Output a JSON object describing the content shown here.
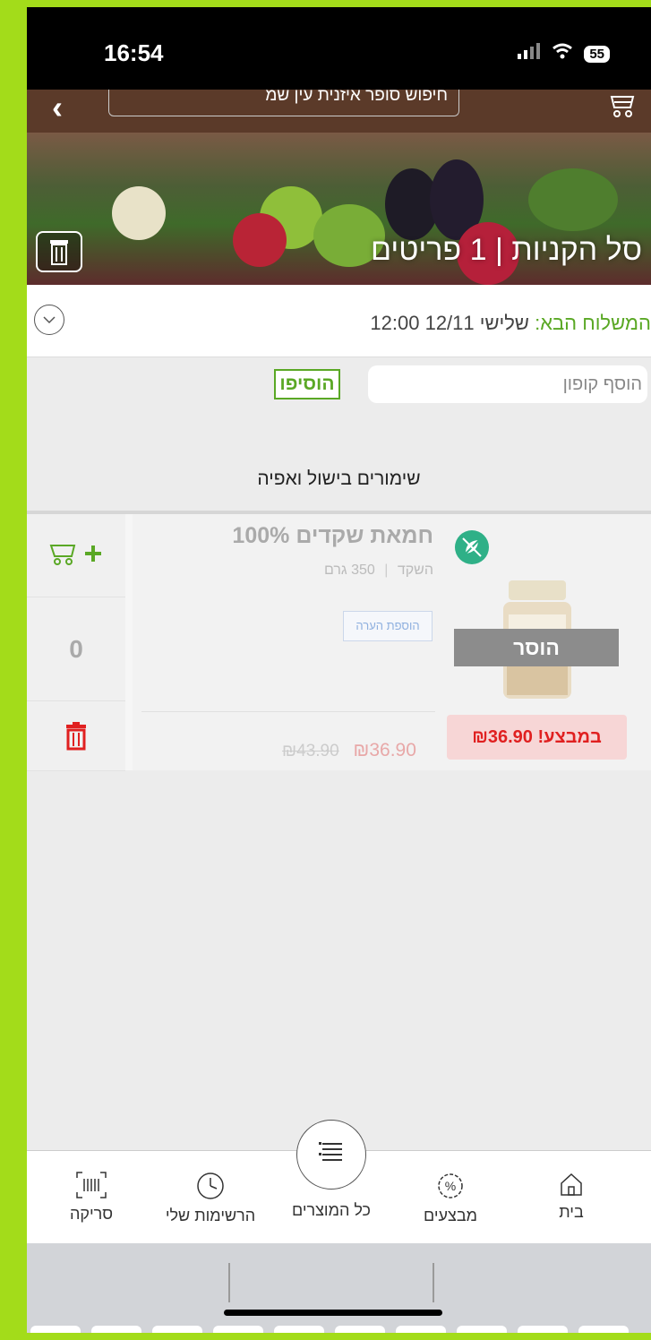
{
  "status_bar": {
    "time": "16:54",
    "battery": "55"
  },
  "header": {
    "search_placeholder": "חיפוש סופר איזנית עין שמ"
  },
  "banner": {
    "title": "סל הקניות | 1 פריטים"
  },
  "delivery": {
    "label": "המשלוח הבא:",
    "value": "שלישי 12/11 12:00"
  },
  "coupon": {
    "placeholder": "הוסף קופון",
    "button": "הוסיפו"
  },
  "category": "שימורים בישול ואפיה",
  "product": {
    "name": "חמאת שקדים 100%",
    "brand": "השקד",
    "weight": "350 גרם",
    "add_note": "הוספת הערה",
    "out_of_stock": "הוסר",
    "sale_label": "במבצע! ₪36.90",
    "price": "₪36.90",
    "old_price": "₪43.90",
    "quantity": "0"
  },
  "nav": {
    "home": "בית",
    "deals": "מבצעים",
    "all_products": "כל המוצרים",
    "my_lists": "הרשימות שלי",
    "scan": "סריקה"
  },
  "colors": {
    "accent_green": "#5aa825",
    "header_brown": "#5b3a29",
    "sale_red": "#e02020",
    "frame_green": "#a3dc1a"
  }
}
